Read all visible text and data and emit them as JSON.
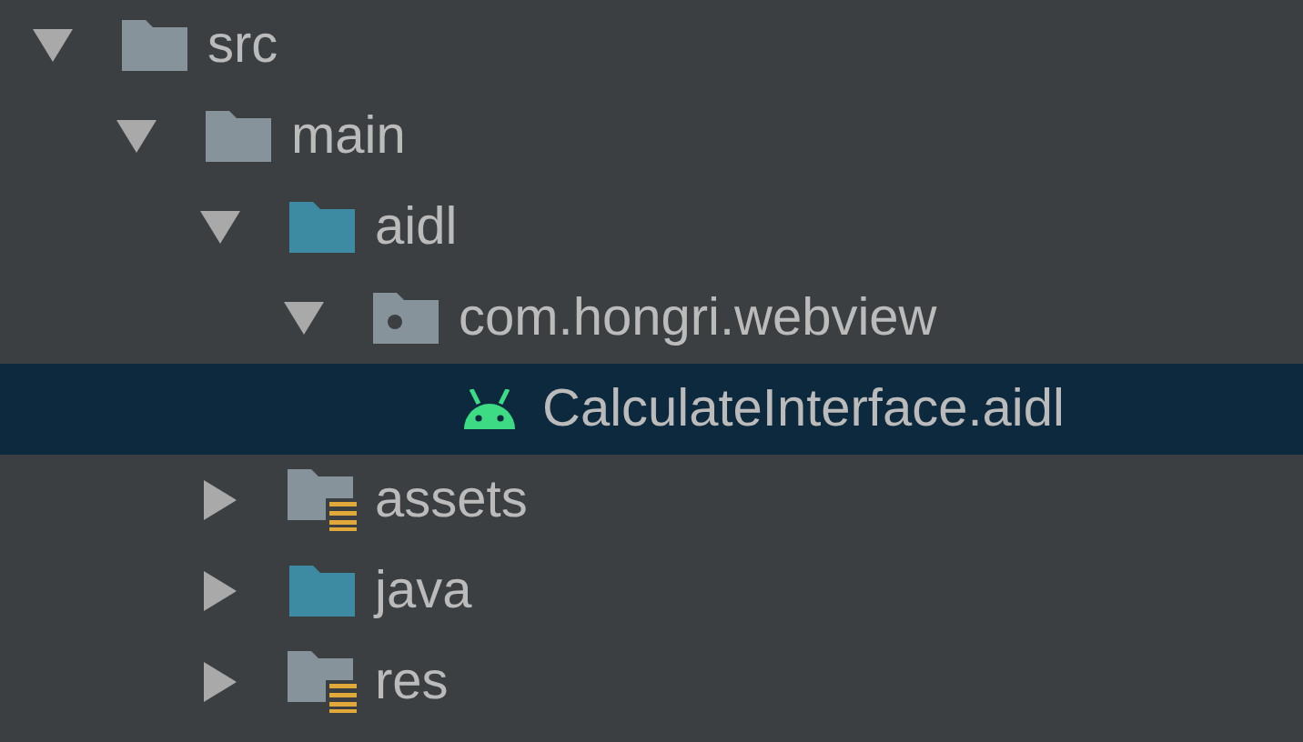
{
  "tree": [
    {
      "label": "src",
      "kind": "folder",
      "expanded": true,
      "selected": false,
      "children": [
        {
          "label": "main",
          "kind": "folder",
          "expanded": true,
          "selected": false,
          "children": [
            {
              "label": "aidl",
              "kind": "source-folder",
              "expanded": true,
              "selected": false,
              "children": [
                {
                  "label": "com.hongri.webview",
                  "kind": "package",
                  "expanded": true,
                  "selected": false,
                  "children": [
                    {
                      "label": "CalculateInterface.aidl",
                      "kind": "android-file",
                      "selected": true
                    }
                  ]
                }
              ]
            },
            {
              "label": "assets",
              "kind": "resource-folder",
              "expanded": false,
              "selected": false
            },
            {
              "label": "java",
              "kind": "source-folder",
              "expanded": false,
              "selected": false
            },
            {
              "label": "res",
              "kind": "resource-folder",
              "expanded": false,
              "selected": false
            }
          ]
        }
      ]
    }
  ]
}
